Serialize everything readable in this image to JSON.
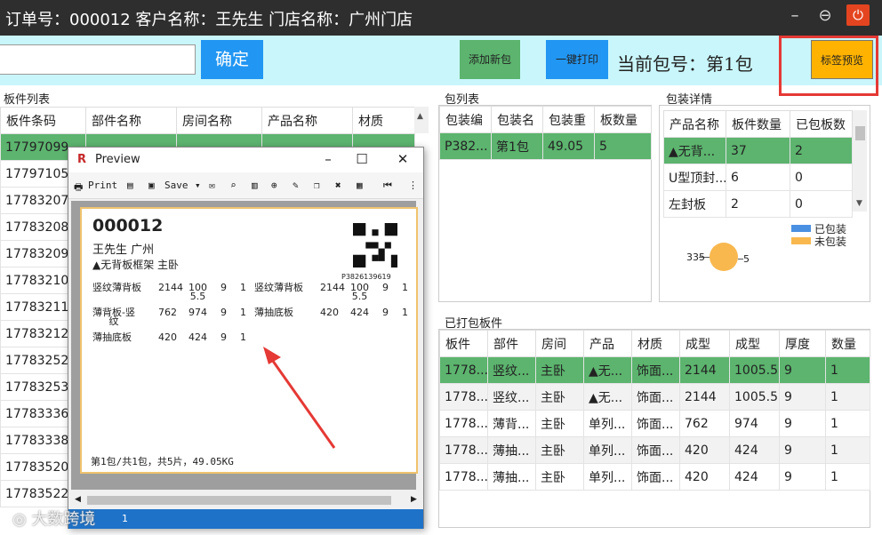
{
  "window": {
    "title": "订单号：000012    客户名称：王先生    门店名称：广州门店"
  },
  "toolbar": {
    "search_value": "",
    "confirm_label": "确定",
    "add_pack_label": "添加新包",
    "print_label": "一键打印",
    "current_pack": "当前包号：第1包",
    "label_preview_label": "标签预览"
  },
  "board_list": {
    "label": "板件列表",
    "columns": [
      "板件条码",
      "部件名称",
      "房间名称",
      "产品名称",
      "材质"
    ],
    "rows": [
      [
        "17797099",
        "",
        "",
        "",
        ""
      ],
      [
        "17797105"
      ],
      [
        "17783207"
      ],
      [
        "17783208"
      ],
      [
        "17783209"
      ],
      [
        "17783210"
      ],
      [
        "17783211"
      ],
      [
        "17783212"
      ],
      [
        "17783252"
      ],
      [
        "17783253"
      ],
      [
        "17783336"
      ],
      [
        "17783338"
      ],
      [
        "17783520"
      ],
      [
        "17783522"
      ]
    ]
  },
  "pack_list": {
    "label": "包列表",
    "columns": [
      "包装编",
      "包装名",
      "包装重",
      "板数量"
    ],
    "rows": [
      [
        "P382...",
        "第1包",
        "49.05",
        "5"
      ]
    ]
  },
  "pack_detail": {
    "label": "包装详情",
    "columns": [
      "产品名称",
      "板件数量",
      "已包板数"
    ],
    "rows": [
      [
        "▲无背...",
        "37",
        "2"
      ],
      [
        "U型顶封...",
        "6",
        "0"
      ],
      [
        "左封板",
        "2",
        "0"
      ]
    ],
    "legend": [
      {
        "name": "已包装",
        "color": "#4a90e2"
      },
      {
        "name": "未包装",
        "color": "#f8b84e"
      }
    ],
    "pie_left": "335",
    "pie_right": "5"
  },
  "packed_boards": {
    "label": "已打包板件",
    "columns": [
      "板件",
      "部件",
      "房间",
      "产品",
      "材质",
      "成型",
      "成型",
      "厚度",
      "数量"
    ],
    "rows": [
      [
        "1778...",
        "竖纹...",
        "主卧",
        "▲无...",
        "饰面...",
        "2144",
        "1005.5",
        "9",
        "1"
      ],
      [
        "1778...",
        "竖纹...",
        "主卧",
        "▲无...",
        "饰面...",
        "2144",
        "1005.5",
        "9",
        "1"
      ],
      [
        "1778...",
        "薄背...",
        "主卧",
        "单列...",
        "饰面...",
        "762",
        "974",
        "9",
        "1"
      ],
      [
        "1778...",
        "薄抽...",
        "主卧",
        "单列...",
        "饰面...",
        "420",
        "424",
        "9",
        "1"
      ],
      [
        "1778...",
        "薄抽...",
        "主卧",
        "单列...",
        "饰面...",
        "420",
        "424",
        "9",
        "1"
      ]
    ]
  },
  "preview": {
    "title": "Preview",
    "print": "Print",
    "save": "Save",
    "status": "1",
    "label": {
      "order_no": "000012",
      "customer": "王先生 广州",
      "product": "▲无背板框架   主卧",
      "code": "P3826139619",
      "left_rows": [
        [
          "竖纹薄背板",
          "2144",
          "100\n5.5",
          "9",
          "1"
        ],
        [
          "薄背板-竖\n纹",
          "762",
          "974",
          "9",
          "1"
        ],
        [
          "薄抽底板",
          "420",
          "424",
          "9",
          "1"
        ]
      ],
      "right_rows": [
        [
          "竖纹薄背板",
          "2144",
          "100\n5.5",
          "9",
          "1"
        ],
        [
          "薄抽底板",
          "420",
          "424",
          "9",
          "1"
        ]
      ],
      "footer": "第1包/共1包，共5片，49.05KG"
    }
  },
  "watermark": "大数跨境"
}
